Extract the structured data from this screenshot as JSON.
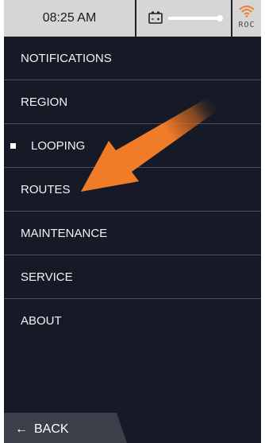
{
  "status_bar": {
    "time": "08:25 AM",
    "battery_icon": "battery-icon",
    "level_fraction": 0.85,
    "wifi_icon": "wifi-signal-icon",
    "badge": "ROC"
  },
  "menu": {
    "items": [
      {
        "label": "NOTIFICATIONS"
      },
      {
        "label": "REGION"
      },
      {
        "label": "LOOPING",
        "selected": true
      },
      {
        "label": "ROUTES"
      },
      {
        "label": "MAINTENANCE"
      },
      {
        "label": "SERVICE"
      },
      {
        "label": "ABOUT"
      }
    ]
  },
  "footer": {
    "back_label": "BACK",
    "back_icon": "arrow-left-icon"
  },
  "colors": {
    "background": "#151a26",
    "status_bar": "#d6d6d6",
    "accent_orange": "#f07c28",
    "text": "#f2f2f2"
  },
  "annotation": {
    "arrow_icon": "orange-pointer-arrow",
    "points_to": "ROUTES"
  }
}
